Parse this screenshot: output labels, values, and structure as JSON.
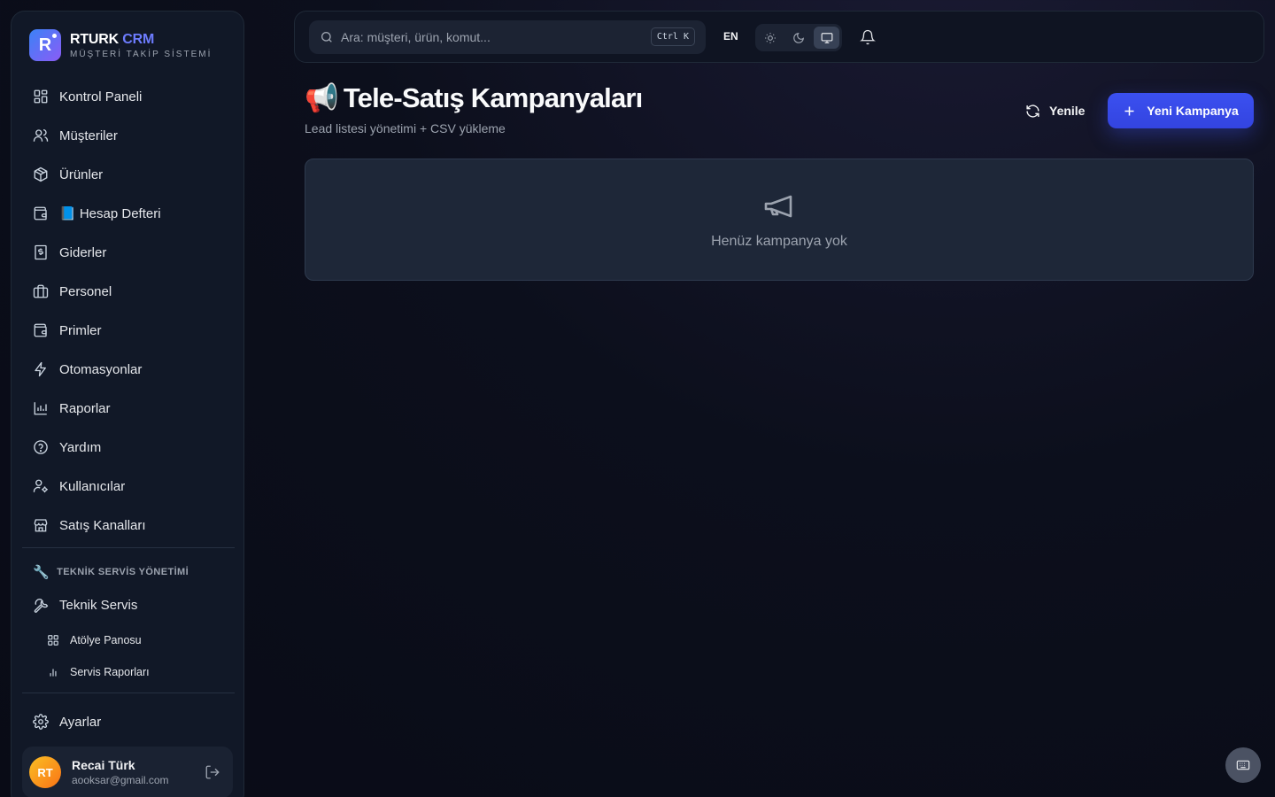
{
  "brand": {
    "logo_letter": "R",
    "name_main": "RTURK",
    "name_accent": "CRM",
    "subtitle": "MÜŞTERİ TAKİP SİSTEMİ"
  },
  "sidebar": {
    "items": [
      {
        "label": "Kontrol Paneli",
        "icon": "dashboard-icon"
      },
      {
        "label": "Müşteriler",
        "icon": "users-icon"
      },
      {
        "label": "Ürünler",
        "icon": "package-icon"
      },
      {
        "label": "📘 Hesap Defteri",
        "icon": "wallet-icon"
      },
      {
        "label": "Giderler",
        "icon": "receipt-icon"
      },
      {
        "label": "Personel",
        "icon": "briefcase-icon"
      },
      {
        "label": "Primler",
        "icon": "wallet-icon"
      },
      {
        "label": "Otomasyonlar",
        "icon": "bolt-icon"
      },
      {
        "label": "Raporlar",
        "icon": "bar-chart-icon"
      },
      {
        "label": "Yardım",
        "icon": "help-icon"
      },
      {
        "label": "Kullanıcılar",
        "icon": "user-cog-icon"
      },
      {
        "label": "Satış Kanalları",
        "icon": "store-icon"
      }
    ],
    "service_section": {
      "heading_icon": "🔧",
      "heading": "TEKNİK SERVİS YÖNETİMİ",
      "main_item": "Teknik Servis",
      "sub_items": [
        "Atölye Panosu",
        "Servis Raporları"
      ]
    },
    "settings_label": "Ayarlar",
    "user": {
      "initials": "RT",
      "name": "Recai Türk",
      "email": "aooksar@gmail.com"
    }
  },
  "topbar": {
    "search_placeholder": "Ara: müşteri, ürün, komut...",
    "shortcut": "Ctrl K",
    "language": "EN",
    "theme_options": [
      "light",
      "dark",
      "system"
    ],
    "theme_selected": "system"
  },
  "page": {
    "title_emoji": "📢",
    "title": "Tele-Satış Kampanyaları",
    "subtitle": "Lead listesi yönetimi + CSV yükleme",
    "refresh_label": "Yenile",
    "new_campaign_label": "Yeni Kampanya",
    "empty_message": "Henüz kampanya yok"
  },
  "colors": {
    "accent": "#3b50f0",
    "brand_accent": "#6d7cff",
    "background": "#0c0f1c",
    "card": "#1e2738"
  }
}
